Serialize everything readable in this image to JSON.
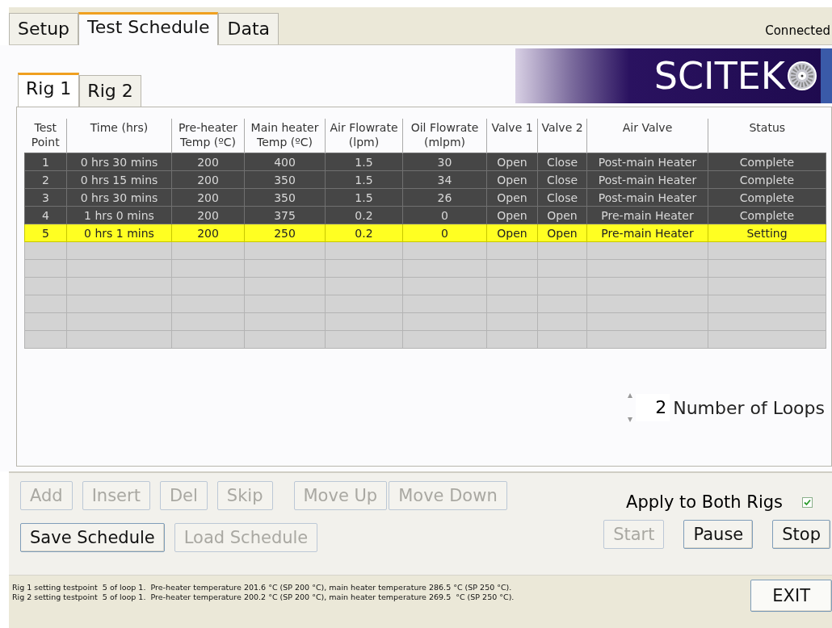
{
  "main_tabs": [
    {
      "label": "Setup",
      "selected": false
    },
    {
      "label": "Test Schedule",
      "selected": true
    },
    {
      "label": "Data",
      "selected": false
    }
  ],
  "connection_status": "Connected",
  "logo": {
    "text": "SCITEK"
  },
  "rig_tabs": [
    {
      "label": "Rig 1",
      "selected": true
    },
    {
      "label": "Rig 2",
      "selected": false
    }
  ],
  "table": {
    "columns": [
      "Test\nPoint",
      "Time (hrs)",
      "Pre-heater\nTemp (ºC)",
      "Main heater\nTemp (ºC)",
      "Air Flowrate\n(lpm)",
      "Oil Flowrate\n(mlpm)",
      "Valve 1",
      "Valve 2",
      "Air Valve",
      "Status"
    ],
    "rows": [
      {
        "done": true,
        "selected": false,
        "cells": [
          "1",
          "0 hrs 30 mins",
          "200",
          "400",
          "1.5",
          "30",
          "Open",
          "Close",
          "Post-main Heater",
          "Complete"
        ]
      },
      {
        "done": true,
        "selected": false,
        "cells": [
          "2",
          "0 hrs 15 mins",
          "200",
          "350",
          "1.5",
          "34",
          "Open",
          "Close",
          "Post-main Heater",
          "Complete"
        ]
      },
      {
        "done": true,
        "selected": false,
        "cells": [
          "3",
          "0 hrs 30 mins",
          "200",
          "350",
          "1.5",
          "26",
          "Open",
          "Close",
          "Post-main Heater",
          "Complete"
        ]
      },
      {
        "done": true,
        "selected": false,
        "cells": [
          "4",
          "1 hrs 0 mins",
          "200",
          "375",
          "0.2",
          "0",
          "Open",
          "Open",
          "Pre-main Heater",
          "Complete"
        ]
      },
      {
        "done": false,
        "selected": true,
        "cells": [
          "5",
          "0 hrs 1 mins",
          "200",
          "250",
          "0.2",
          "0",
          "Open",
          "Open",
          "Pre-main Heater",
          "Setting"
        ]
      }
    ]
  },
  "loops": {
    "value": "2",
    "label": "Number of Loops"
  },
  "edit_buttons": [
    {
      "label": "Add",
      "disabled": true
    },
    {
      "label": "Insert",
      "disabled": true
    },
    {
      "label": "Del",
      "disabled": true
    },
    {
      "label": "Skip",
      "disabled": true
    }
  ],
  "move_buttons": [
    {
      "label": "Move Up",
      "disabled": true
    },
    {
      "label": "Move Down",
      "disabled": true
    }
  ],
  "file_buttons": [
    {
      "label": "Save Schedule",
      "disabled": false
    },
    {
      "label": "Load Schedule",
      "disabled": true
    }
  ],
  "apply_both": {
    "label": "Apply to Both Rigs",
    "checked": true
  },
  "run_buttons": [
    {
      "label": "Start",
      "disabled": true
    },
    {
      "label": "Pause",
      "disabled": false
    },
    {
      "label": "Stop",
      "disabled": false
    }
  ],
  "status_lines": [
    "Rig 1 setting testpoint  5 of loop 1.  Pre-heater temperature 201.6 °C (SP 200 °C), main heater temperature 286.5 °C (SP 250 °C).",
    "Rig 2 setting testpoint  5 of loop 1.  Pre-heater temperature 200.2 °C (SP 200 °C), main heater temperature 269.5  °C (SP 250 °C)."
  ],
  "exit_button": {
    "label": "EXIT",
    "disabled": false
  }
}
